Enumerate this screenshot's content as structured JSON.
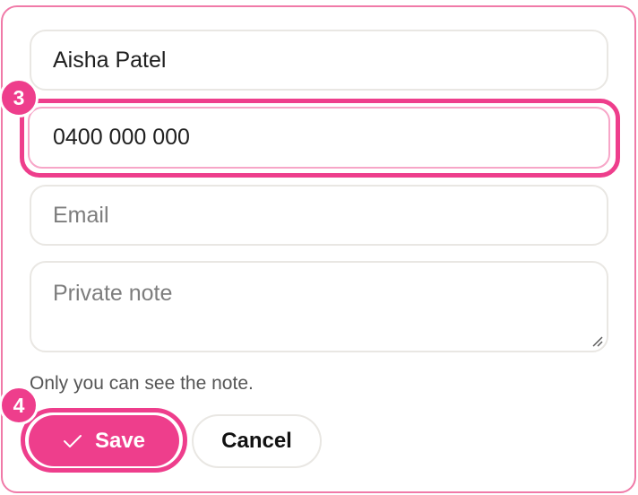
{
  "form": {
    "name_value": "Aisha Patel",
    "phone_value": "0400 000 000",
    "email_placeholder": "Email",
    "note_placeholder": "Private note",
    "helper_text": "Only you can see the note."
  },
  "badges": {
    "phone_step": "3",
    "save_step": "4"
  },
  "actions": {
    "save_label": "Save",
    "cancel_label": "Cancel"
  },
  "colors": {
    "accent": "#ee3e8c",
    "card_border": "#f07aa8",
    "field_border": "#e9e7e3"
  },
  "icons": {
    "save": "check-icon",
    "note_corner": "resize-handle-icon"
  }
}
